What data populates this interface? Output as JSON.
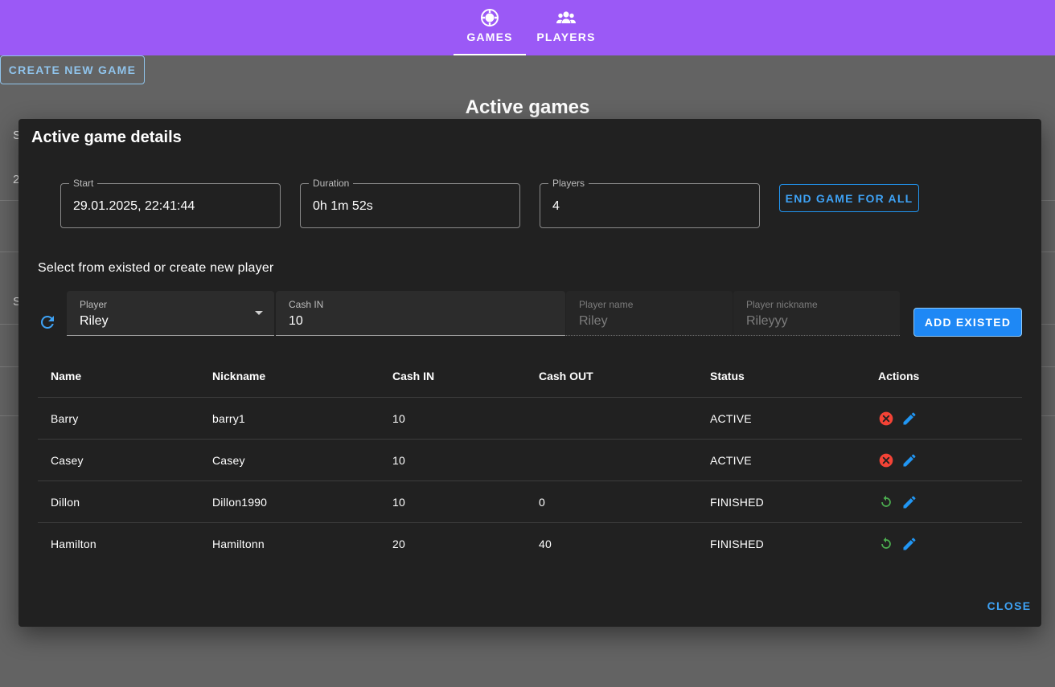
{
  "nav": {
    "games_label": "GAMES",
    "players_label": "PLAYERS"
  },
  "page": {
    "create_button": "CREATE NEW GAME",
    "title": "Active games",
    "fragments": [
      "S",
      "2",
      "S"
    ]
  },
  "dialog": {
    "title": "Active game details",
    "start": {
      "label": "Start",
      "value": "29.01.2025, 22:41:44"
    },
    "duration": {
      "label": "Duration",
      "value": "0h 1m 52s"
    },
    "players": {
      "label": "Players",
      "value": "4"
    },
    "end_game_button": "END GAME FOR ALL",
    "subheading": "Select from existed or create new player",
    "form": {
      "player": {
        "label": "Player",
        "value": "Riley"
      },
      "cash_in": {
        "label": "Cash IN",
        "value": "10"
      },
      "player_name": {
        "label": "Player name",
        "value": "Riley"
      },
      "player_nickname": {
        "label": "Player nickname",
        "value": "Rileyyy"
      },
      "add_button": "ADD EXISTED"
    },
    "table": {
      "headers": [
        "Name",
        "Nickname",
        "Cash IN",
        "Cash OUT",
        "Status",
        "Actions"
      ],
      "rows": [
        {
          "name": "Barry",
          "nickname": "barry1",
          "cash_in": "10",
          "cash_out": "",
          "status": "ACTIVE",
          "primary_action_icon": "cancel-icon"
        },
        {
          "name": "Casey",
          "nickname": "Casey",
          "cash_in": "10",
          "cash_out": "",
          "status": "ACTIVE",
          "primary_action_icon": "cancel-icon"
        },
        {
          "name": "Dillon",
          "nickname": "Dillon1990",
          "cash_in": "10",
          "cash_out": "0",
          "status": "FINISHED",
          "primary_action_icon": "restore-icon"
        },
        {
          "name": "Hamilton",
          "nickname": "Hamiltonn",
          "cash_in": "20",
          "cash_out": "40",
          "status": "FINISHED",
          "primary_action_icon": "restore-icon"
        }
      ]
    },
    "close_button": "CLOSE"
  },
  "colors": {
    "topbar": "#9b59f6",
    "accent": "#2196f3",
    "danger": "#f44336",
    "success": "#4caf50",
    "dialog_bg": "#212121"
  }
}
